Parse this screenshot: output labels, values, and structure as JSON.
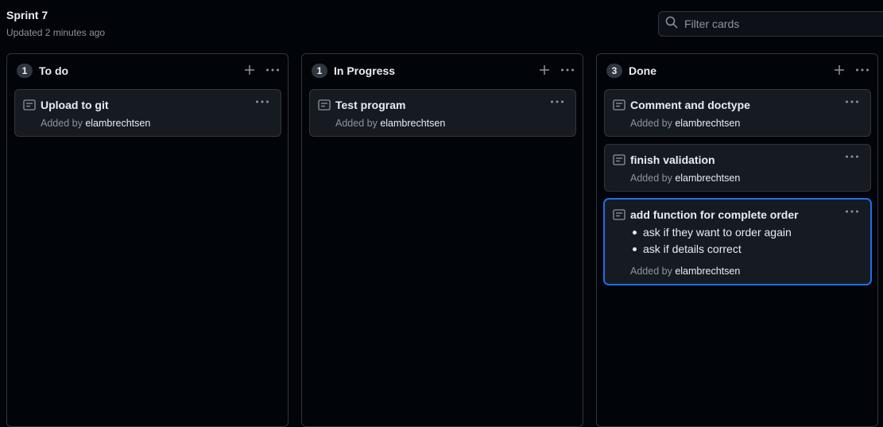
{
  "board": {
    "title": "Sprint 7",
    "updated": "Updated 2 minutes ago",
    "filter_placeholder": "Filter cards"
  },
  "columns": [
    {
      "name": "To do",
      "count": "1",
      "cards": [
        {
          "title": "Upload to git",
          "added_by_label": "Added by",
          "author": "elambrechtsen"
        }
      ]
    },
    {
      "name": "In Progress",
      "count": "1",
      "cards": [
        {
          "title": "Test program",
          "added_by_label": "Added by",
          "author": "elambrechtsen"
        }
      ]
    },
    {
      "name": "Done",
      "count": "3",
      "cards": [
        {
          "title": "Comment and doctype",
          "added_by_label": "Added by",
          "author": "elambrechtsen"
        },
        {
          "title": "finish validation",
          "added_by_label": "Added by",
          "author": "elambrechtsen"
        },
        {
          "title": "add function for complete order",
          "items": [
            "ask if they want to order again",
            "ask if details correct"
          ],
          "added_by_label": "Added by",
          "author": "elambrechtsen"
        }
      ]
    }
  ],
  "colors": {
    "background": "#010409",
    "card": "#161b22",
    "border": "#30363d",
    "muted_text": "#8b949e",
    "selected_border": "#1f6feb"
  },
  "icons": [
    "search-icon",
    "plus-icon",
    "kebab-menu-icon",
    "note-icon"
  ]
}
